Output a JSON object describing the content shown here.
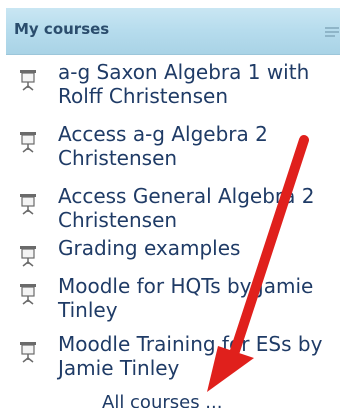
{
  "block": {
    "title": "My courses",
    "hide_icon": "collapse-block-icon",
    "courses": [
      {
        "label": "a-g Saxon Algebra 1 with Rolff Christensen",
        "icon": "course-icon"
      },
      {
        "label": "Access a-g Algebra 2 Christensen",
        "icon": "course-icon"
      },
      {
        "label": "Access General Algebra 2 Christensen",
        "icon": "course-icon"
      },
      {
        "label": "Grading examples",
        "icon": "course-icon"
      },
      {
        "label": "Moodle for HQTs by Jamie Tinley",
        "icon": "course-icon"
      },
      {
        "label": "Moodle Training for ESs by Jamie Tinley",
        "icon": "course-icon"
      }
    ],
    "all_courses": "All courses ..."
  },
  "annotation": {
    "arrow_color": "#e0201c",
    "icon": "red-arrow-annotation"
  }
}
